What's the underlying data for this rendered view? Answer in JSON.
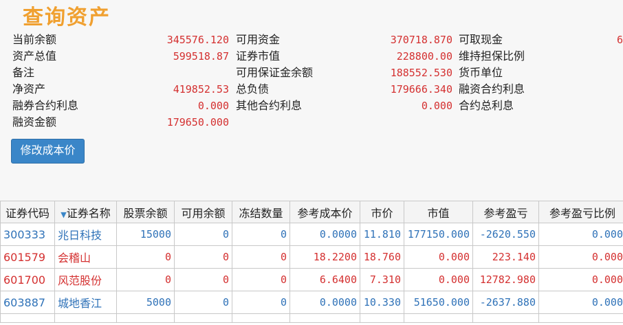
{
  "title": "查询资产",
  "summary": {
    "col1": [
      {
        "label": "当前余额",
        "value": "345576.120"
      },
      {
        "label": "资产总值",
        "value": "599518.87"
      },
      {
        "label": "备注",
        "value": ""
      },
      {
        "label": "净资产",
        "value": "419852.53"
      },
      {
        "label": "融券合约利息",
        "value": "0.000"
      },
      {
        "label": "融资金额",
        "value": "179650.000"
      }
    ],
    "col2": [
      {
        "label": "可用资金",
        "value": "370718.870"
      },
      {
        "label": "证券市值",
        "value": "228800.00"
      },
      {
        "label": "可用保证金余额",
        "value": "188552.530"
      },
      {
        "label": "总负债",
        "value": "179666.340"
      },
      {
        "label": "其他合约利息",
        "value": "0.000"
      }
    ],
    "col3": [
      {
        "label": "可取现金",
        "value": "6"
      },
      {
        "label": "维持担保比例",
        "value": ""
      },
      {
        "label": "货币单位",
        "value": ""
      },
      {
        "label": "融资合约利息",
        "value": ""
      },
      {
        "label": "合约总利息",
        "value": ""
      }
    ]
  },
  "edit_cost_button": "修改成本价",
  "sort_arrow": "▼",
  "table": {
    "headers": [
      "证券代码",
      "证券名称",
      "股票余额",
      "可用余额",
      "冻结数量",
      "参考成本价",
      "市价",
      "市值",
      "参考盈亏",
      "参考盈亏比例"
    ],
    "rows": [
      {
        "tone": "blue",
        "cells": [
          "300333",
          "兆日科技",
          "15000",
          "0",
          "0",
          "0.0000",
          "11.810",
          "177150.000",
          "-2620.550",
          "0.000"
        ]
      },
      {
        "tone": "red",
        "cells": [
          "601579",
          "会稽山",
          "0",
          "0",
          "0",
          "18.2200",
          "18.760",
          "0.000",
          "223.140",
          "0.000"
        ]
      },
      {
        "tone": "red",
        "cells": [
          "601700",
          "风范股份",
          "0",
          "0",
          "0",
          "6.6400",
          "7.310",
          "0.000",
          "12782.980",
          "0.000"
        ]
      },
      {
        "tone": "blue",
        "cells": [
          "603887",
          "城地香江",
          "5000",
          "0",
          "0",
          "0.0000",
          "10.330",
          "51650.000",
          "-2637.880",
          "0.000"
        ]
      }
    ]
  },
  "colors": {
    "title": "#f0a030",
    "value_red": "#d43030",
    "row_blue": "#2f72b8",
    "button_blue": "#3a86c8"
  }
}
